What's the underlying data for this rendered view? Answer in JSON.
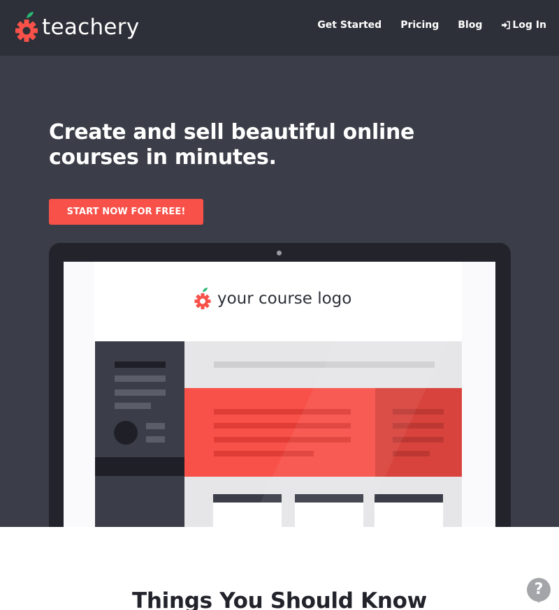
{
  "brand": {
    "name": "teachery",
    "logo_icon": "apple-gear-icon",
    "colors": {
      "accent": "#f85149",
      "header_bg": "#2d3038",
      "hero_bg": "#3b3e48",
      "leaf": "#2bb673"
    }
  },
  "nav": {
    "items": [
      {
        "label": "Get Started"
      },
      {
        "label": "Pricing"
      },
      {
        "label": "Blog"
      },
      {
        "label": "Log In",
        "icon": "login-arrow-icon"
      }
    ]
  },
  "hero": {
    "headline_line1": "Create and sell beautiful online",
    "headline_line2": "courses in minutes.",
    "cta_label": "START NOW FOR FREE!"
  },
  "mockup": {
    "course_logo_text": "your course logo"
  },
  "section": {
    "title": "Things You Should Know"
  },
  "help": {
    "label": "?"
  }
}
